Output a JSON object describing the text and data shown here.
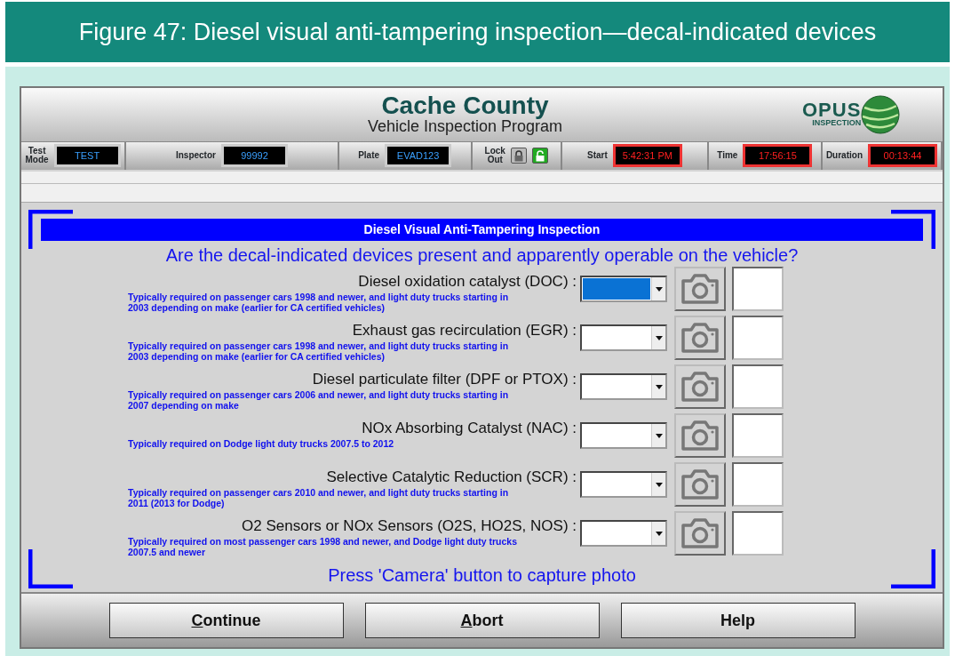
{
  "figure_title": "Figure 47: Diesel visual anti-tampering inspection—decal-indicated devices",
  "header": {
    "title": "Cache County",
    "subtitle": "Vehicle Inspection Program",
    "logo": {
      "word": "OPUS",
      "tagline": "INSPECTION"
    }
  },
  "status_fields": [
    {
      "label": "Test Mode",
      "value": "TEST",
      "kind": "id"
    },
    {
      "label": "Inspector",
      "value": "99992",
      "kind": "id"
    },
    {
      "label": "Plate",
      "value": "EVAD123",
      "kind": "id"
    },
    {
      "label": "Lock Out",
      "kind": "lock",
      "locked": false
    },
    {
      "label": "Start",
      "value": "5:42:31 PM",
      "kind": "clock"
    },
    {
      "label": "Time",
      "value": "17:56:15",
      "kind": "clock"
    },
    {
      "label": "Duration",
      "value": "00:13:44",
      "kind": "clock"
    }
  ],
  "panel": {
    "title": "Diesel Visual Anti-Tampering Inspection",
    "question": "Are the decal-indicated devices present and apparently operable on the vehicle?",
    "devices": [
      {
        "label": "Diesel oxidation catalyst (DOC) :",
        "hint": "Typically required on passenger cars 1998 and newer, and light duty trucks starting in 2003 depending on make (earlier for CA certified vehicles)",
        "selected": true
      },
      {
        "label": "Exhaust gas recirculation (EGR) :",
        "hint": "Typically required on passenger cars 1998 and newer, and light duty trucks starting in 2003 depending on make (earlier for CA certified vehicles)",
        "selected": false
      },
      {
        "label": "Diesel particulate filter (DPF or PTOX) :",
        "hint": "Typically required on passenger cars 2006 and newer, and light duty trucks starting in 2007 depending on make",
        "selected": false
      },
      {
        "label": "NOx Absorbing Catalyst (NAC) :",
        "hint": "Typically required on Dodge light duty trucks 2007.5 to 2012",
        "selected": false
      },
      {
        "label": "Selective Catalytic Reduction (SCR) :",
        "hint": "Typically required on passenger cars 2010 and newer, and light duty trucks starting in 2011 (2013 for Dodge)",
        "selected": false
      },
      {
        "label": "O2 Sensors or NOx Sensors (O2S, HO2S, NOS) :",
        "hint": "Typically required on most passenger cars 1998 and newer, and Dodge light duty trucks 2007.5 and newer",
        "selected": false
      }
    ],
    "footer": "Press 'Camera' button to capture photo"
  },
  "buttons": [
    {
      "mnemonic": "C",
      "rest": "ontinue"
    },
    {
      "mnemonic": "A",
      "rest": "bort"
    },
    {
      "rest": "Help"
    }
  ]
}
